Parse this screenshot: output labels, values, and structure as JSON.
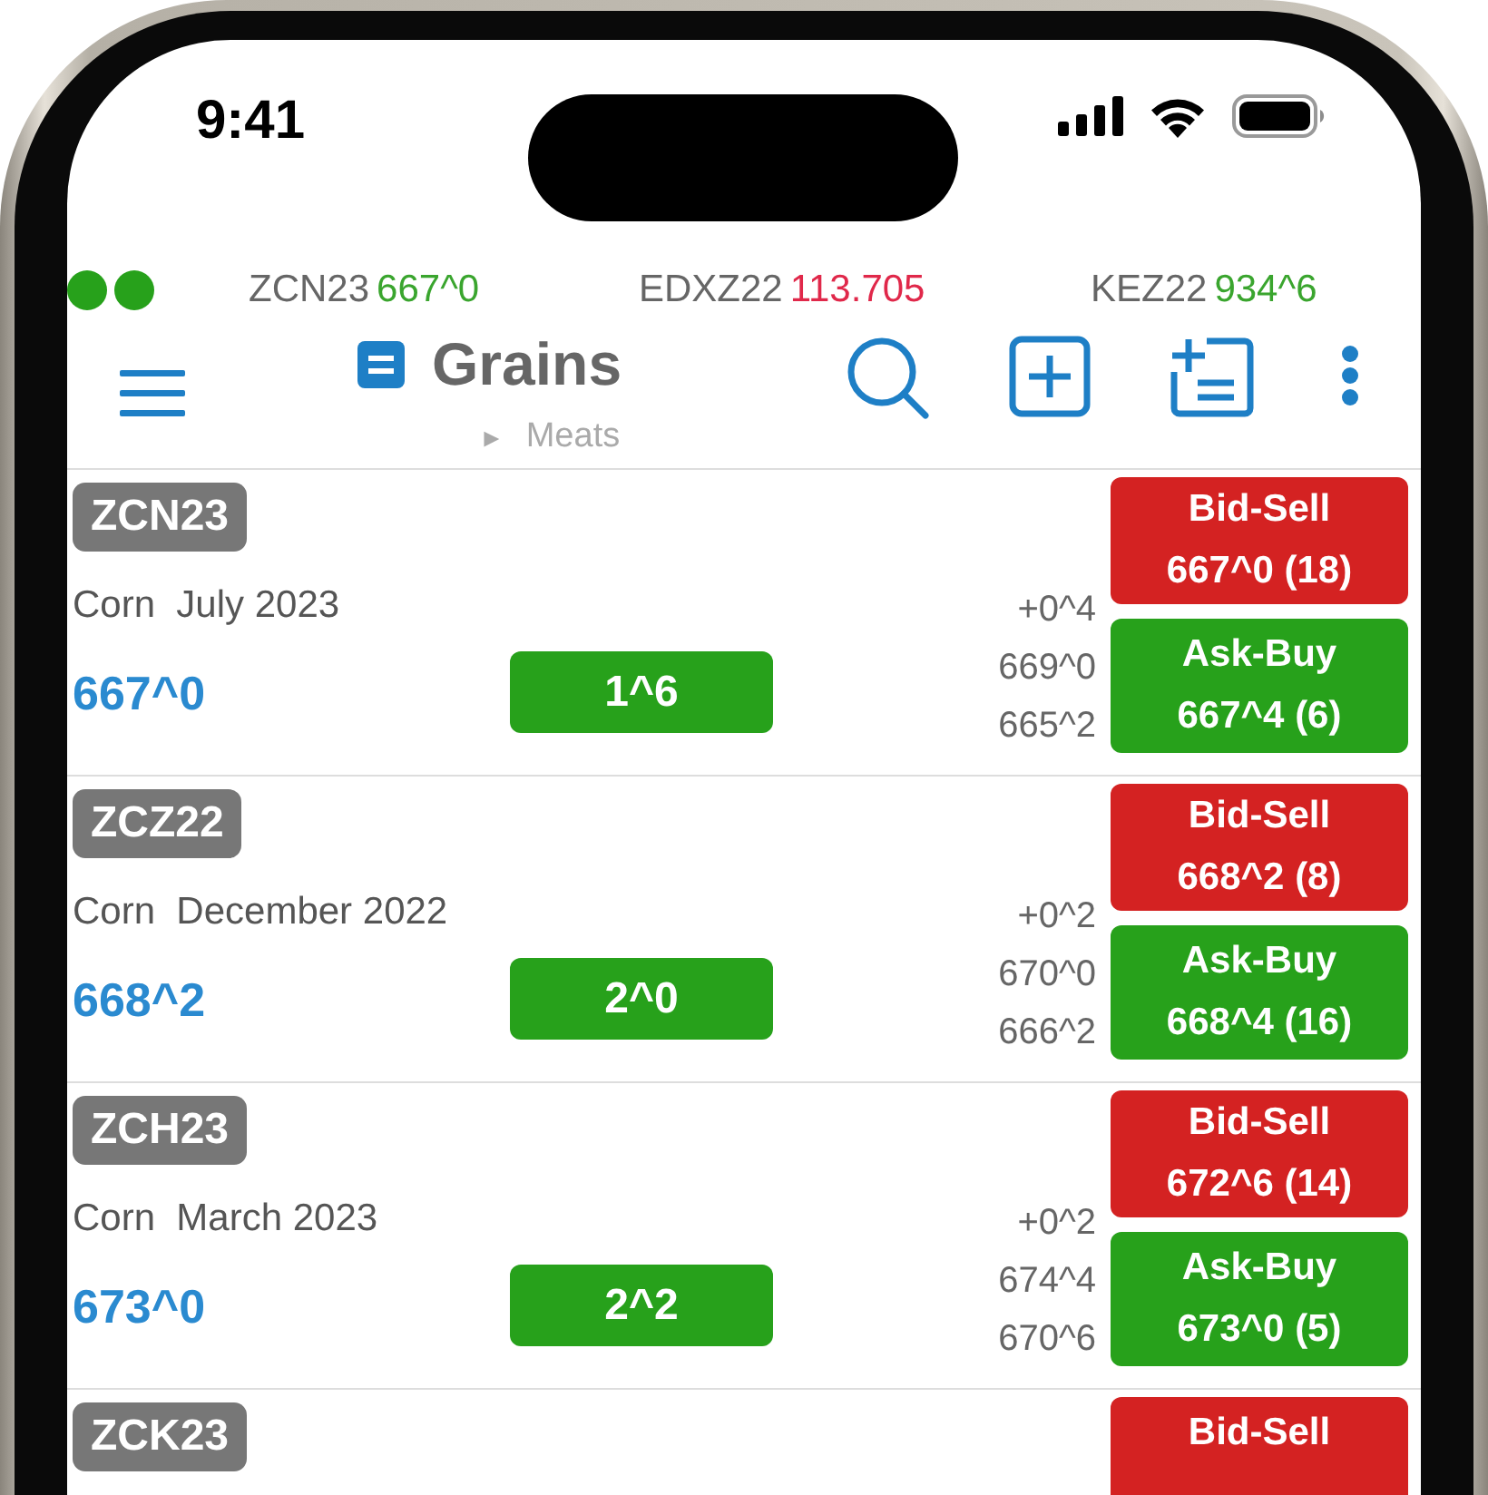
{
  "status_bar": {
    "time": "9:41"
  },
  "ticker": [
    {
      "symbol": "ZCN23",
      "price": "667^0",
      "color": "#3aa52e"
    },
    {
      "symbol": "EDXZ22",
      "price": "113.705",
      "color": "#e0284a"
    },
    {
      "symbol": "KEZ22",
      "price": "934^6",
      "color": "#3aa52e"
    }
  ],
  "header": {
    "title": "Grains",
    "subtitle_marker": "►",
    "subtitle": "Meats"
  },
  "contracts": [
    {
      "symbol": "ZCN23",
      "description": "Corn  July 2023",
      "last": "667^0",
      "change": "1^6",
      "net": "+0^4",
      "high": "669^0",
      "low": "665^2",
      "bid_label": "Bid-Sell",
      "bid": "667^0 (18)",
      "ask_label": "Ask-Buy",
      "ask": "667^4 (6)"
    },
    {
      "symbol": "ZCZ22",
      "description": "Corn  December 2022",
      "last": "668^2",
      "change": "2^0",
      "net": "+0^2",
      "high": "670^0",
      "low": "666^2",
      "bid_label": "Bid-Sell",
      "bid": "668^2 (8)",
      "ask_label": "Ask-Buy",
      "ask": "668^4 (16)"
    },
    {
      "symbol": "ZCH23",
      "description": "Corn  March 2023",
      "last": "673^0",
      "change": "2^2",
      "net": "+0^2",
      "high": "674^4",
      "low": "670^6",
      "bid_label": "Bid-Sell",
      "bid": "672^6 (14)",
      "ask_label": "Ask-Buy",
      "ask": "673^0 (5)"
    },
    {
      "symbol": "ZCK23",
      "bid_label": "Bid-Sell"
    }
  ]
}
